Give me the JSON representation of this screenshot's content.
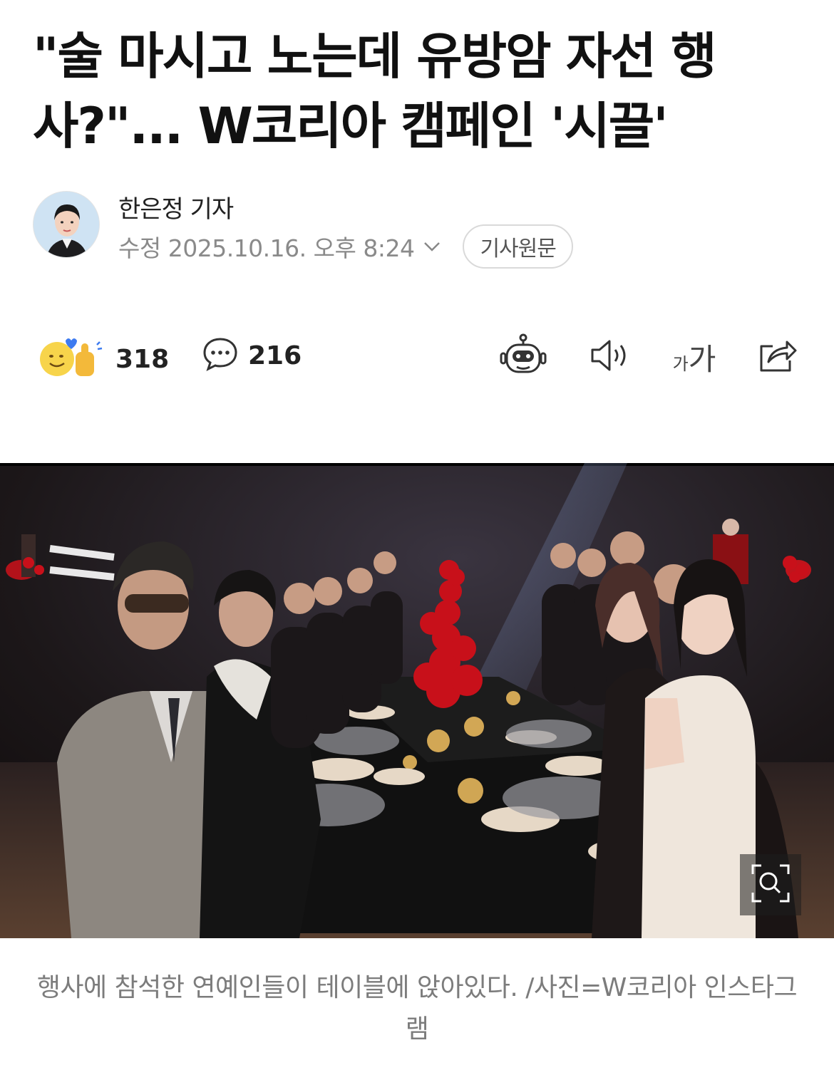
{
  "article": {
    "headline": "\"술 마시고 노는데 유방암 자선 행사?\"... W코리아 캠페인 '시끌'",
    "reporter": "한은정 기자",
    "timestamp": "수정 2025.10.16. 오후 8:24",
    "original_button": "기사원문"
  },
  "actions": {
    "reaction_count": "318",
    "comment_count": "216",
    "font_small": "가",
    "font_big": "가"
  },
  "photo": {
    "caption": "행사에 참석한 연예인들이 테이블에 앉아있다. /사진=W코리아 인스타그램"
  },
  "colors": {
    "accent_red": "#c8101a",
    "muted_text": "#8a8a8a",
    "border": "#d9d9d9"
  },
  "icons": [
    "avatar",
    "chevron-down-icon",
    "reaction-emoji-icon",
    "comment-icon",
    "ai-bot-icon",
    "speaker-icon",
    "font-size-icon",
    "share-icon",
    "zoom-icon"
  ]
}
